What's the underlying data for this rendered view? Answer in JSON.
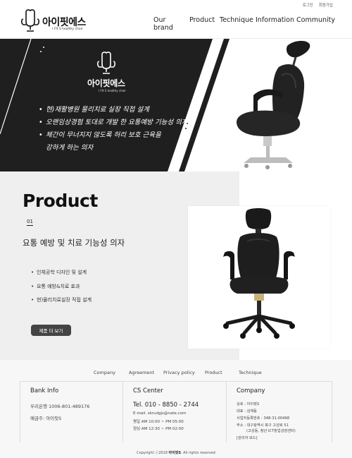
{
  "utility": {
    "login": "로그인",
    "signup": "회원가입"
  },
  "logo": {
    "brand": "아이핏에스",
    "small": "I FIT S",
    "sub": "I FIt S  healthy chair"
  },
  "nav": [
    "Our brand",
    "Product",
    "Technique",
    "Information",
    "Community"
  ],
  "hero": {
    "brand": "아이핏에스",
    "small": "I FIT S",
    "sub": "I FIt S  healthy chair",
    "bullet": "•",
    "lines": [
      "현)재활병원 물리치료 실장 직접 설계",
      "오랜임상경험 토대로 개발 한 요통예방 기능성 의자",
      "체간이 무너지지 않도록 허리 보호 근육을",
      "강하게 하는 의자"
    ],
    "colors": {
      "dark": "#1f1f1f"
    }
  },
  "product": {
    "title": "Product",
    "number": "01",
    "subtitle": "요통 예방 및 치료 기능성 의자",
    "bullet": "•",
    "features": [
      "인체공학 디자인 및 설계",
      "요통 예방&치료 효과",
      "현)물리치료실장 직접 설계"
    ],
    "button": "제품 더 보기"
  },
  "footer": {
    "nav": [
      "Company",
      "Agreement",
      "Privacy policy",
      "Product",
      "Technique"
    ],
    "bank": {
      "title": "Bank Info",
      "account": "우리은행 1006-801-489176",
      "holder": "예금주: 아이핏S"
    },
    "cs": {
      "title": "CS Center",
      "tel": "Tel. 010 - 8850 - 2744",
      "email": "E-mail. skrudgjs@nate.com",
      "weekday": "평일 AM 10:00 ~ PM 05:00",
      "lunch": "점심 AM 12:30 ~ PM 02:00"
    },
    "company": {
      "title": "Company",
      "name": "상호 : 아이핏S",
      "ceo": "대표 : 김재동",
      "biz": "사업자등록번호 : 348-31-00468",
      "addr1": "주소 : 대구광역시 북구 고성로 51",
      "addr2": "(고성동, 청년 ICT창업성장센터)",
      "admin": "[관리자 모드]"
    },
    "copyright_prefix": "Copyright ⓒ2018 ",
    "copyright_brand": "아이핏S",
    "copyright_suffix": ". All rights reserved"
  }
}
